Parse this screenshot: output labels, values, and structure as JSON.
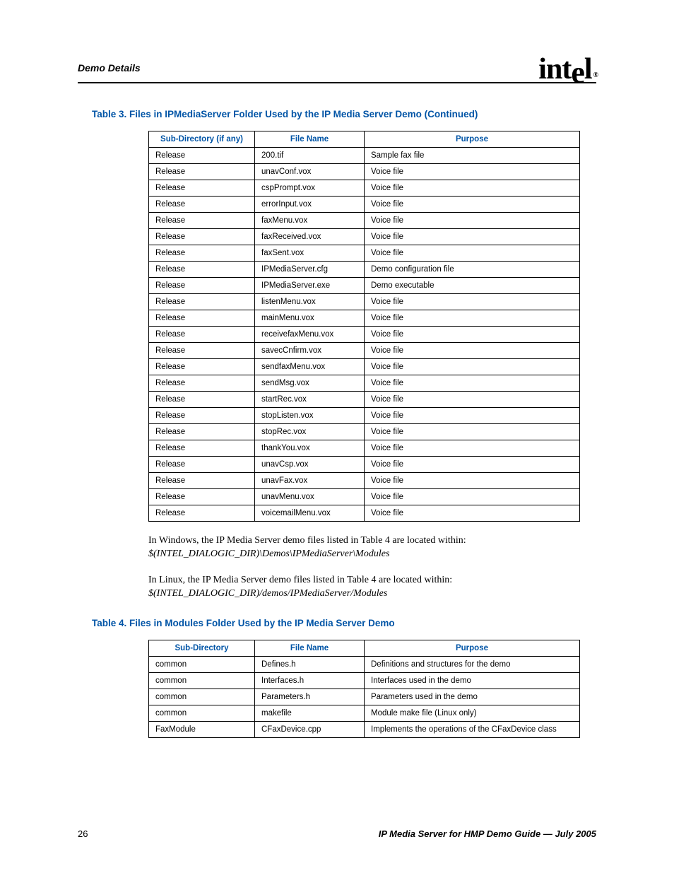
{
  "header": {
    "section_title": "Demo Details"
  },
  "table3": {
    "caption": "Table 3.  Files in IPMediaServer Folder Used by the IP Media Server Demo (Continued)",
    "columns": [
      "Sub-Directory (if any)",
      "File Name",
      "Purpose"
    ],
    "rows": [
      [
        "Release",
        "200.tif",
        "Sample fax file"
      ],
      [
        "Release",
        "unavConf.vox",
        "Voice file"
      ],
      [
        "Release",
        "cspPrompt.vox",
        "Voice file"
      ],
      [
        "Release",
        "errorInput.vox",
        "Voice file"
      ],
      [
        "Release",
        "faxMenu.vox",
        "Voice file"
      ],
      [
        "Release",
        "faxReceived.vox",
        "Voice file"
      ],
      [
        "Release",
        "faxSent.vox",
        "Voice file"
      ],
      [
        "Release",
        "IPMediaServer.cfg",
        "Demo configuration file"
      ],
      [
        "Release",
        "IPMediaServer.exe",
        "Demo executable"
      ],
      [
        "Release",
        "listenMenu.vox",
        "Voice file"
      ],
      [
        "Release",
        "mainMenu.vox",
        "Voice file"
      ],
      [
        "Release",
        "receivefaxMenu.vox",
        "Voice file"
      ],
      [
        "Release",
        "savecCnfirm.vox",
        "Voice file"
      ],
      [
        "Release",
        "sendfaxMenu.vox",
        "Voice file"
      ],
      [
        "Release",
        "sendMsg.vox",
        "Voice file"
      ],
      [
        "Release",
        "startRec.vox",
        "Voice file"
      ],
      [
        "Release",
        "stopListen.vox",
        "Voice file"
      ],
      [
        "Release",
        "stopRec.vox",
        "Voice file"
      ],
      [
        "Release",
        "thankYou.vox",
        "Voice file"
      ],
      [
        "Release",
        "unavCsp.vox",
        "Voice file"
      ],
      [
        "Release",
        "unavFax.vox",
        "Voice file"
      ],
      [
        "Release",
        "unavMenu.vox",
        "Voice file"
      ],
      [
        "Release",
        "voicemailMenu.vox",
        "Voice file"
      ]
    ]
  },
  "paragraph1": {
    "line1": "In Windows, the IP Media Server demo files listed in Table 4 are located within:",
    "line2": "$(INTEL_DIALOGIC_DIR)\\Demos\\IPMediaServer\\Modules"
  },
  "paragraph2": {
    "line1": "In Linux, the IP Media Server demo files listed in Table 4 are located within:",
    "line2": "$(INTEL_DIALOGIC_DIR)/demos/IPMediaServer/Modules"
  },
  "table4": {
    "caption": "Table 4.  Files in Modules Folder Used by the IP Media Server Demo",
    "columns": [
      "Sub-Directory",
      "File Name",
      "Purpose"
    ],
    "rows": [
      [
        "common",
        "Defines.h",
        "Definitions and structures for the demo"
      ],
      [
        "common",
        "Interfaces.h",
        "Interfaces used in the demo"
      ],
      [
        "common",
        "Parameters.h",
        "Parameters used in the demo"
      ],
      [
        "common",
        "makefile",
        "Module make file (Linux only)"
      ],
      [
        "FaxModule",
        "CFaxDevice.cpp",
        "Implements the operations of the CFaxDevice class"
      ]
    ]
  },
  "footer": {
    "page": "26",
    "title": "IP Media Server for HMP Demo Guide — July 2005"
  }
}
